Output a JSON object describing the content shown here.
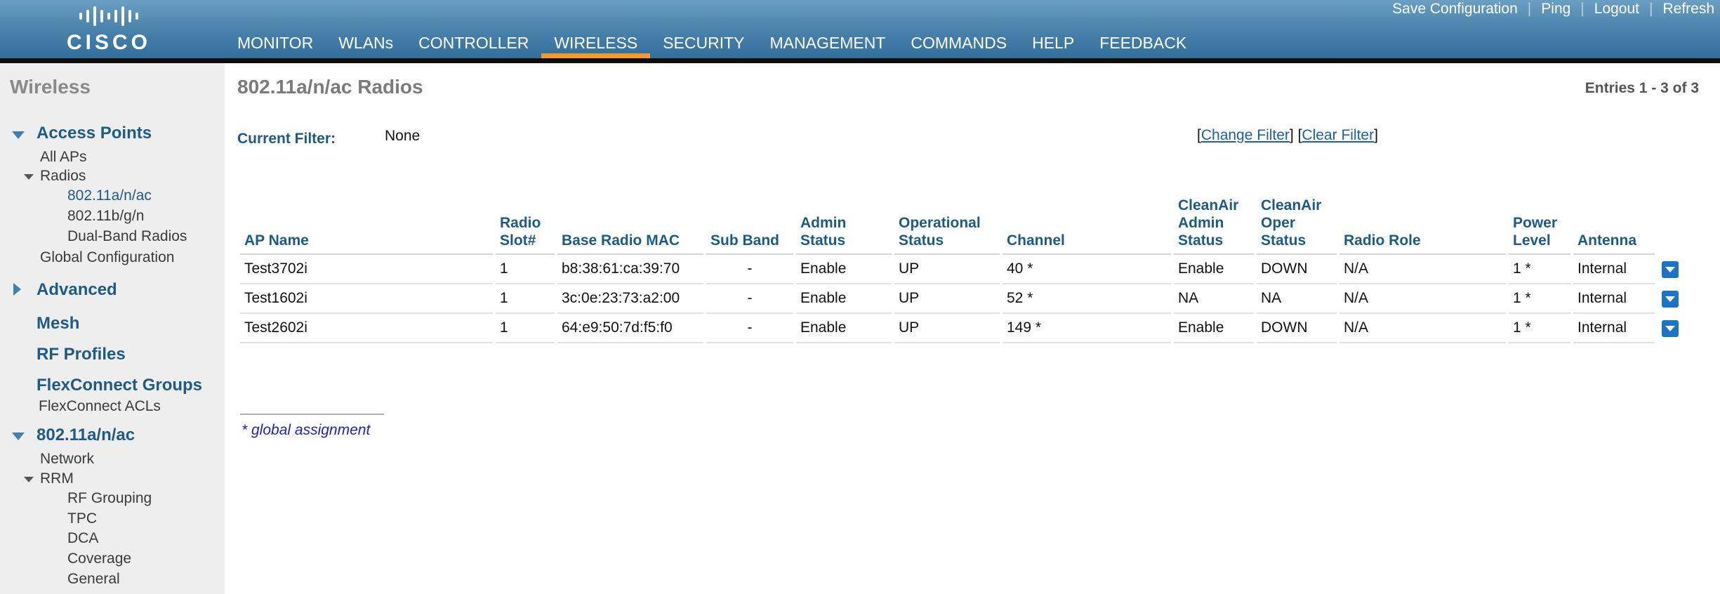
{
  "header": {
    "logo_text": "CISCO",
    "top_links": [
      "Save Configuration",
      "Ping",
      "Logout",
      "Refresh"
    ],
    "nav": [
      "MONITOR",
      "WLANs",
      "CONTROLLER",
      "WIRELESS",
      "SECURITY",
      "MANAGEMENT",
      "COMMANDS",
      "HELP",
      "FEEDBACK"
    ],
    "active_nav": "WIRELESS",
    "colors": {
      "header_blue": "#4a83ad",
      "active_tab_underline": "#f39a2a"
    }
  },
  "sidebar": {
    "title": "Wireless",
    "access_points": "Access Points",
    "all_aps": "All APs",
    "radios": "Radios",
    "radio_80211a": "802.11a/n/ac",
    "radio_80211b": "802.11b/g/n",
    "dual_band": "Dual-Band Radios",
    "global_config": "Global Configuration",
    "advanced": "Advanced",
    "mesh": "Mesh",
    "rf_profiles": "RF Profiles",
    "flexconnect_groups": "FlexConnect Groups",
    "flexconnect_acls": "FlexConnect ACLs",
    "section_80211a": "802.11a/n/ac",
    "network": "Network",
    "rrm": "RRM",
    "rf_grouping": "RF Grouping",
    "tpc": "TPC",
    "dca": "DCA",
    "coverage": "Coverage",
    "general": "General"
  },
  "main": {
    "title": "802.11a/n/ac Radios",
    "entries": "Entries 1 - 3 of 3",
    "filter_label": "Current Filter:",
    "filter_value": "None",
    "change_filter": "Change Filter",
    "clear_filter": "Clear Filter",
    "columns": [
      [
        "AP Name"
      ],
      [
        "Radio",
        "Slot#"
      ],
      [
        "Base Radio MAC"
      ],
      [
        "Sub Band"
      ],
      [
        "Admin",
        "Status"
      ],
      [
        "Operational",
        "Status"
      ],
      [
        "Channel"
      ],
      [
        "CleanAir",
        "Admin",
        "Status"
      ],
      [
        "CleanAir",
        "Oper",
        "Status"
      ],
      [
        "Radio Role"
      ],
      [
        "Power",
        "Level"
      ],
      [
        "Antenna"
      ]
    ],
    "rows": [
      {
        "ap_name": "Test3702i",
        "slot": "1",
        "mac": "b8:38:61:ca:39:70",
        "sub_band": "-",
        "admin": "Enable",
        "oper": "UP",
        "channel": "40 *",
        "ca_admin": "Enable",
        "ca_oper": "DOWN",
        "role": "N/A",
        "power": "1 *",
        "antenna": "Internal"
      },
      {
        "ap_name": "Test1602i",
        "slot": "1",
        "mac": "3c:0e:23:73:a2:00",
        "sub_band": "-",
        "admin": "Enable",
        "oper": "UP",
        "channel": "52 *",
        "ca_admin": "NA",
        "ca_oper": "NA",
        "role": "N/A",
        "power": "1 *",
        "antenna": "Internal"
      },
      {
        "ap_name": "Test2602i",
        "slot": "1",
        "mac": "64:e9:50:7d:f5:f0",
        "sub_band": "-",
        "admin": "Enable",
        "oper": "UP",
        "channel": "149 *",
        "ca_admin": "Enable",
        "ca_oper": "DOWN",
        "role": "N/A",
        "power": "1 *",
        "antenna": "Internal"
      }
    ],
    "footnote": "* global assignment"
  }
}
